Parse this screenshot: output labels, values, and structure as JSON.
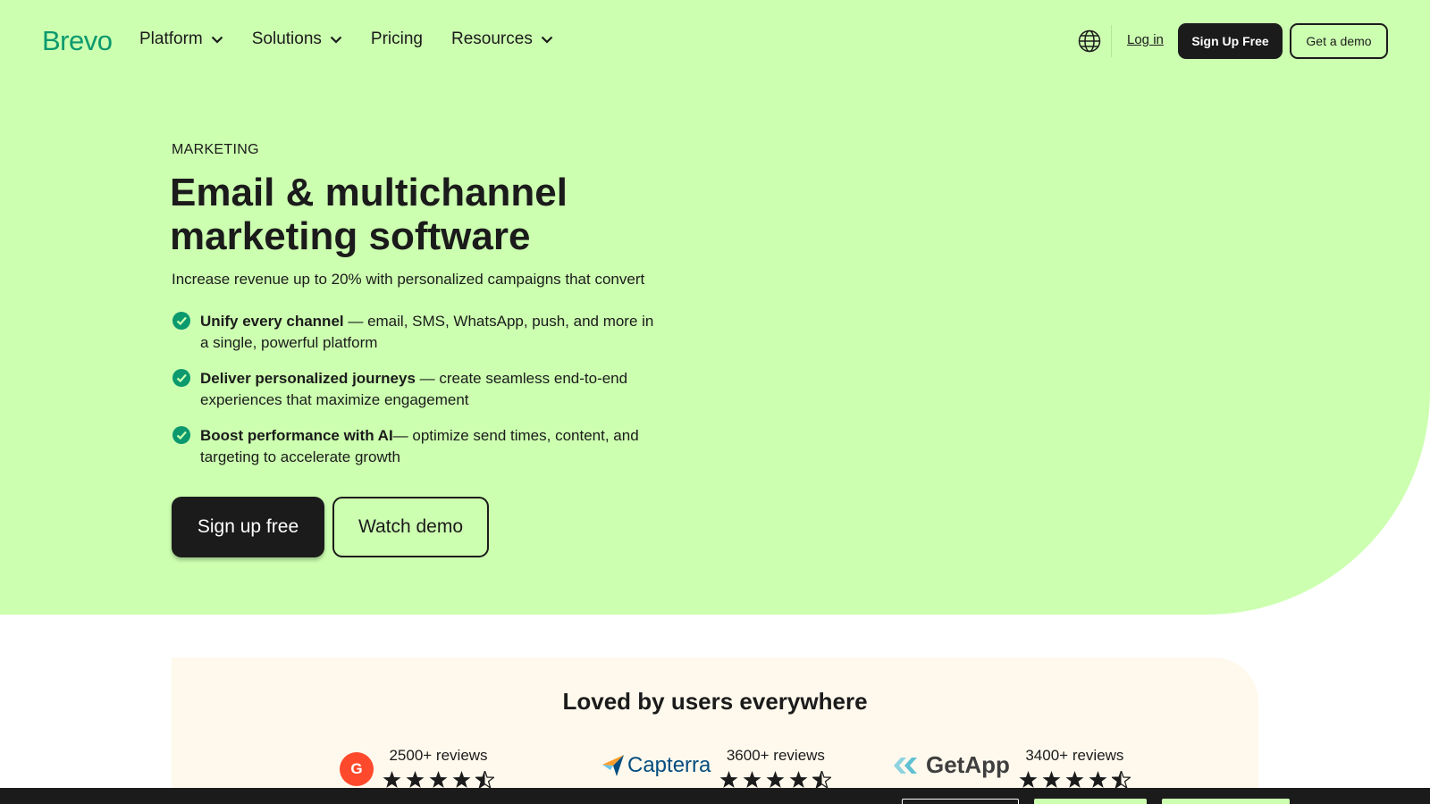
{
  "nav": {
    "logo": "Brevo",
    "links": [
      {
        "label": "Platform",
        "dropdown": true
      },
      {
        "label": "Solutions",
        "dropdown": true
      },
      {
        "label": "Pricing",
        "dropdown": false
      },
      {
        "label": "Resources",
        "dropdown": true
      }
    ],
    "language_icon": "globe-icon",
    "login": "Log in",
    "signup": "Sign Up Free",
    "demo": "Get a demo"
  },
  "hero": {
    "eyebrow": "MARKETING",
    "headline": "Email & multichannel marketing software",
    "subline": "Increase revenue up to 20% with personalized campaigns that convert",
    "features": [
      {
        "bold": "Unify every channel",
        "text": " — email, SMS, WhatsApp, push, and more in a single, powerful platform"
      },
      {
        "bold": "Deliver personalized journeys",
        "text": " — create seamless end-to-end experiences that maximize engagement"
      },
      {
        "bold": "Boost performance with AI",
        "text": "— optimize send times, content, and targeting to accelerate growth"
      }
    ],
    "cta_primary": "Sign up free",
    "cta_secondary": "Watch demo"
  },
  "reviews": {
    "title": "Loved by users everywhere",
    "items": [
      {
        "platform": "G2",
        "logo_text": "G",
        "count": "2500+ reviews",
        "rating": 4.5
      },
      {
        "platform": "Capterra",
        "logo_text": "Capterra",
        "count": "3600+ reviews",
        "rating": 4.5
      },
      {
        "platform": "GetApp",
        "logo_text": "GetApp",
        "count": "3400+ reviews",
        "rating": 4.5
      }
    ]
  },
  "colors": {
    "hero_bg": "#ccffb0",
    "brand_green": "#0b996e",
    "dark": "#1b1b1b",
    "reviews_bg": "#fff9ed",
    "g2_red": "#ff492c"
  }
}
